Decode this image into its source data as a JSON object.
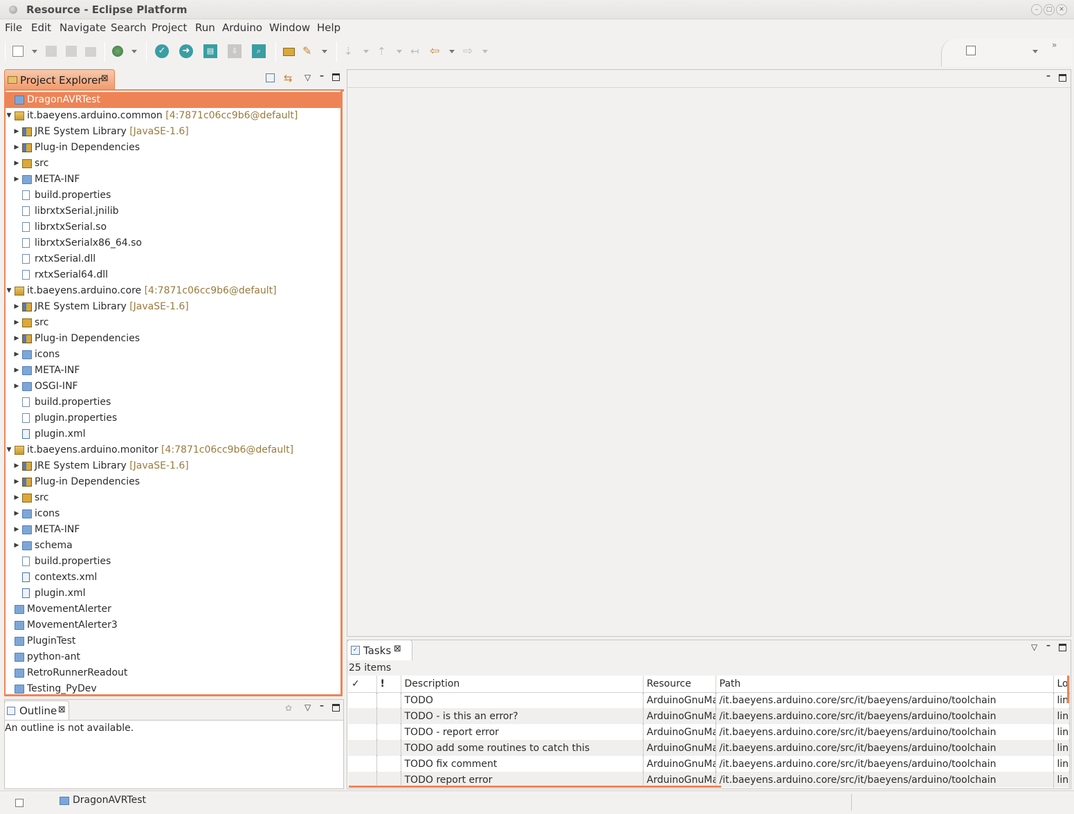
{
  "window": {
    "title": "Resource - Eclipse Platform"
  },
  "menu": [
    "File",
    "Edit",
    "Navigate",
    "Search",
    "Project",
    "Run",
    "Arduino",
    "Window",
    "Help"
  ],
  "project_explorer": {
    "tab_label": "Project Explorer",
    "tree": [
      {
        "label": "DragonAVRTest",
        "decoration": "",
        "icon": "folder-icon",
        "depth": 0,
        "twisty": "",
        "selected": true
      },
      {
        "label": "it.baeyens.arduino.common",
        "decoration": "[4:7871c06cc9b6@default]",
        "icon": "plugin-project-icon",
        "depth": 0,
        "twisty": "open"
      },
      {
        "label": "JRE System Library",
        "decoration": "[JavaSE-1.6]",
        "icon": "library-icon",
        "depth": 1,
        "twisty": "closed"
      },
      {
        "label": "Plug-in Dependencies",
        "decoration": "",
        "icon": "library-icon",
        "depth": 1,
        "twisty": "closed"
      },
      {
        "label": "src",
        "decoration": "",
        "icon": "source-folder-icon",
        "depth": 1,
        "twisty": "closed"
      },
      {
        "label": "META-INF",
        "decoration": "",
        "icon": "folder-icon",
        "depth": 1,
        "twisty": "closed"
      },
      {
        "label": "build.properties",
        "decoration": "",
        "icon": "file-icon",
        "depth": 1,
        "twisty": ""
      },
      {
        "label": "librxtxSerial.jnilib",
        "decoration": "",
        "icon": "file-icon",
        "depth": 1,
        "twisty": ""
      },
      {
        "label": "librxtxSerial.so",
        "decoration": "",
        "icon": "file-icon",
        "depth": 1,
        "twisty": ""
      },
      {
        "label": "librxtxSerialx86_64.so",
        "decoration": "",
        "icon": "file-icon",
        "depth": 1,
        "twisty": ""
      },
      {
        "label": "rxtxSerial.dll",
        "decoration": "",
        "icon": "file-icon",
        "depth": 1,
        "twisty": ""
      },
      {
        "label": "rxtxSerial64.dll",
        "decoration": "",
        "icon": "file-icon",
        "depth": 1,
        "twisty": ""
      },
      {
        "label": "it.baeyens.arduino.core",
        "decoration": "[4:7871c06cc9b6@default]",
        "icon": "plugin-project-icon",
        "depth": 0,
        "twisty": "open"
      },
      {
        "label": "JRE System Library",
        "decoration": "[JavaSE-1.6]",
        "icon": "library-icon",
        "depth": 1,
        "twisty": "closed"
      },
      {
        "label": "src",
        "decoration": "",
        "icon": "source-folder-icon",
        "depth": 1,
        "twisty": "closed"
      },
      {
        "label": "Plug-in Dependencies",
        "decoration": "",
        "icon": "library-icon",
        "depth": 1,
        "twisty": "closed"
      },
      {
        "label": "icons",
        "decoration": "",
        "icon": "folder-icon",
        "depth": 1,
        "twisty": "closed"
      },
      {
        "label": "META-INF",
        "decoration": "",
        "icon": "folder-icon",
        "depth": 1,
        "twisty": "closed"
      },
      {
        "label": "OSGI-INF",
        "decoration": "",
        "icon": "folder-icon",
        "depth": 1,
        "twisty": "closed"
      },
      {
        "label": "build.properties",
        "decoration": "",
        "icon": "file-icon",
        "depth": 1,
        "twisty": ""
      },
      {
        "label": "plugin.properties",
        "decoration": "",
        "icon": "file-icon",
        "depth": 1,
        "twisty": ""
      },
      {
        "label": "plugin.xml",
        "decoration": "",
        "icon": "xml-file-icon",
        "depth": 1,
        "twisty": ""
      },
      {
        "label": "it.baeyens.arduino.monitor",
        "decoration": "[4:7871c06cc9b6@default]",
        "icon": "plugin-project-icon",
        "depth": 0,
        "twisty": "open"
      },
      {
        "label": "JRE System Library",
        "decoration": "[JavaSE-1.6]",
        "icon": "library-icon",
        "depth": 1,
        "twisty": "closed"
      },
      {
        "label": "Plug-in Dependencies",
        "decoration": "",
        "icon": "library-icon",
        "depth": 1,
        "twisty": "closed"
      },
      {
        "label": "src",
        "decoration": "",
        "icon": "source-folder-icon",
        "depth": 1,
        "twisty": "closed"
      },
      {
        "label": "icons",
        "decoration": "",
        "icon": "folder-icon",
        "depth": 1,
        "twisty": "closed"
      },
      {
        "label": "META-INF",
        "decoration": "",
        "icon": "folder-icon",
        "depth": 1,
        "twisty": "closed"
      },
      {
        "label": "schema",
        "decoration": "",
        "icon": "folder-icon",
        "depth": 1,
        "twisty": "closed"
      },
      {
        "label": "build.properties",
        "decoration": "",
        "icon": "file-icon",
        "depth": 1,
        "twisty": ""
      },
      {
        "label": "contexts.xml",
        "decoration": "",
        "icon": "xml-file-icon",
        "depth": 1,
        "twisty": ""
      },
      {
        "label": "plugin.xml",
        "decoration": "",
        "icon": "xml-file-icon",
        "depth": 1,
        "twisty": ""
      },
      {
        "label": "MovementAlerter",
        "decoration": "",
        "icon": "folder-icon",
        "depth": 0,
        "twisty": ""
      },
      {
        "label": "MovementAlerter3",
        "decoration": "",
        "icon": "folder-icon",
        "depth": 0,
        "twisty": ""
      },
      {
        "label": "PluginTest",
        "decoration": "",
        "icon": "folder-icon",
        "depth": 0,
        "twisty": ""
      },
      {
        "label": "python-ant",
        "decoration": "",
        "icon": "folder-icon",
        "depth": 0,
        "twisty": ""
      },
      {
        "label": "RetroRunnerReadout",
        "decoration": "",
        "icon": "folder-icon",
        "depth": 0,
        "twisty": ""
      },
      {
        "label": "Testing_PyDev",
        "decoration": "",
        "icon": "folder-icon",
        "depth": 0,
        "twisty": ""
      }
    ]
  },
  "outline": {
    "tab_label": "Outline",
    "message": "An outline is not available."
  },
  "tasks": {
    "tab_label": "Tasks",
    "count_text": "25 items",
    "columns": [
      "✓",
      "!",
      "Description",
      "Resource",
      "Path",
      "Lo"
    ],
    "rows": [
      {
        "description": "TODO",
        "resource": "ArduinoGnuMa",
        "path": "/it.baeyens.arduino.core/src/it/baeyens/arduino/toolchain",
        "location": "lin"
      },
      {
        "description": "TODO - is this an error?",
        "resource": "ArduinoGnuMa",
        "path": "/it.baeyens.arduino.core/src/it/baeyens/arduino/toolchain",
        "location": "lin"
      },
      {
        "description": "TODO - report error",
        "resource": "ArduinoGnuMa",
        "path": "/it.baeyens.arduino.core/src/it/baeyens/arduino/toolchain",
        "location": "lin"
      },
      {
        "description": "TODO add some routines to catch this",
        "resource": "ArduinoGnuMa",
        "path": "/it.baeyens.arduino.core/src/it/baeyens/arduino/toolchain",
        "location": "lin"
      },
      {
        "description": "TODO fix comment",
        "resource": "ArduinoGnuMa",
        "path": "/it.baeyens.arduino.core/src/it/baeyens/arduino/toolchain",
        "location": "lin"
      },
      {
        "description": "TODO report error",
        "resource": "ArduinoGnuMa",
        "path": "/it.baeyens.arduino.core/src/it/baeyens/arduino/toolchain",
        "location": "lin"
      }
    ]
  },
  "status_bar": {
    "selection": "DragonAVRTest"
  },
  "colors": {
    "accent": "#ee8456",
    "decoration": "#9a7b3c",
    "button_teal": "#3a9ea3"
  }
}
